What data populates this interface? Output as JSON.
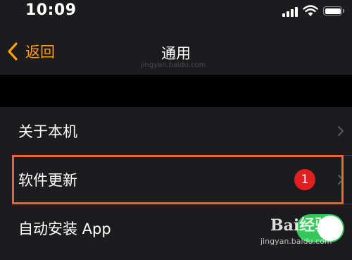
{
  "status_bar": {
    "time": "10:09"
  },
  "nav": {
    "back_label": "返回",
    "title": "通用"
  },
  "watermark_top": "jingyan.baidu.com",
  "rows": [
    {
      "label": "关于本机"
    },
    {
      "label": "软件更新",
      "badge": "1"
    },
    {
      "label": "自动安装 App",
      "toggle_on": true
    }
  ],
  "watermark": {
    "logo_text": "Bai经验",
    "url": "jingyan.baidu.com"
  },
  "colors": {
    "accent": "#ff9f0a",
    "toggle_on": "#34c759",
    "badge": "#e02020",
    "highlight_box": "#e8643a"
  }
}
